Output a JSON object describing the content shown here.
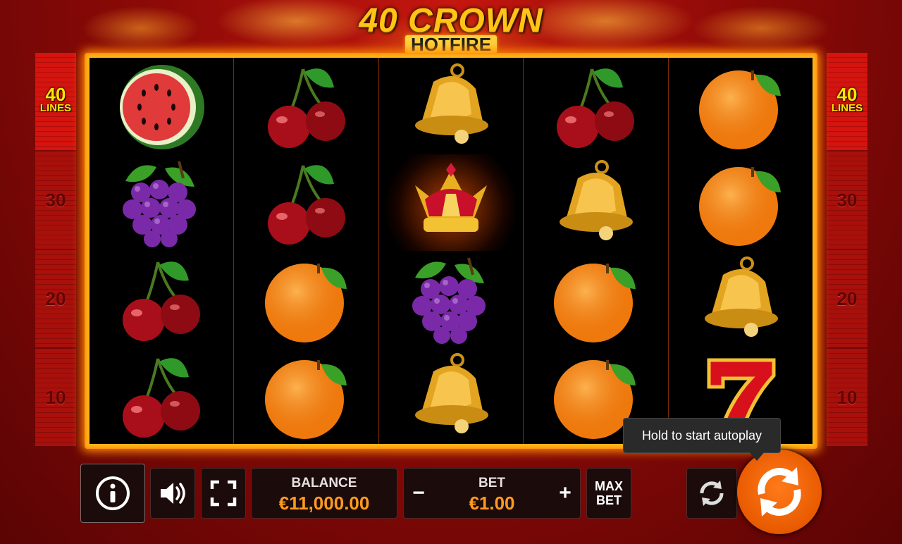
{
  "logo": {
    "title": "40 CROWN",
    "subtitle": "HOTFIRE"
  },
  "paylines": {
    "top_count": "40",
    "top_word": "LINES",
    "markers": [
      "30",
      "20",
      "10"
    ]
  },
  "reels": [
    [
      "watermelon",
      "grapes",
      "cherry",
      "cherry"
    ],
    [
      "cherry",
      "cherry",
      "orange",
      "orange"
    ],
    [
      "bell",
      "crown",
      "grapes",
      "bell"
    ],
    [
      "cherry",
      "bell",
      "orange",
      "orange"
    ],
    [
      "orange",
      "orange",
      "bell",
      "seven"
    ]
  ],
  "controls": {
    "info_icon": "info-icon",
    "sound_icon": "speaker-icon",
    "fullscreen_icon": "fullscreen-icon",
    "balance_label": "BALANCE",
    "balance_value": "€11,000.00",
    "bet_label": "BET",
    "bet_value": "€1.00",
    "bet_decrease": "−",
    "bet_increase": "+",
    "maxbet_line1": "MAX",
    "maxbet_line2": "BET",
    "autoplay_icon": "autoplay-icon",
    "spin_icon": "spin-arrows-icon",
    "tooltip": "Hold to start autoplay"
  },
  "colors": {
    "accent": "#ff9a1e",
    "frame": "#ffb319",
    "spin_button": "#e85a00"
  }
}
